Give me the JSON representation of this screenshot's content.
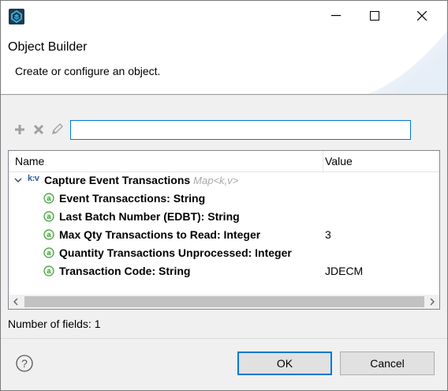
{
  "window": {
    "title": "Object Builder",
    "message": "Create or configure an object."
  },
  "toolbar": {
    "add_icon": "plus-icon",
    "delete_icon": "delete-x-icon",
    "edit_icon": "pencil-icon",
    "filter_value": ""
  },
  "table": {
    "columns": {
      "name": "Name",
      "value": "Value"
    },
    "root": {
      "icon": "k:v",
      "label": "Capture Event Transactions",
      "type": "Map<k,v>"
    },
    "rows": [
      {
        "label": "Event Transacctions: String",
        "value": ""
      },
      {
        "label": "Last Batch Number (EDBT): String",
        "value": ""
      },
      {
        "label": "Max Qty Transactions to Read: Integer",
        "value": "3"
      },
      {
        "label": "Quantity Transactions Unprocessed: Integer",
        "value": ""
      },
      {
        "label": "Transaction Code: String",
        "value": "JDECM"
      }
    ]
  },
  "status": {
    "field_count": "Number of fields: 1"
  },
  "buttons": {
    "ok": "OK",
    "cancel": "Cancel"
  },
  "colors": {
    "accent": "#0078d7",
    "attr_green": "#3f9c35",
    "kv_blue": "#2a5d9f"
  }
}
